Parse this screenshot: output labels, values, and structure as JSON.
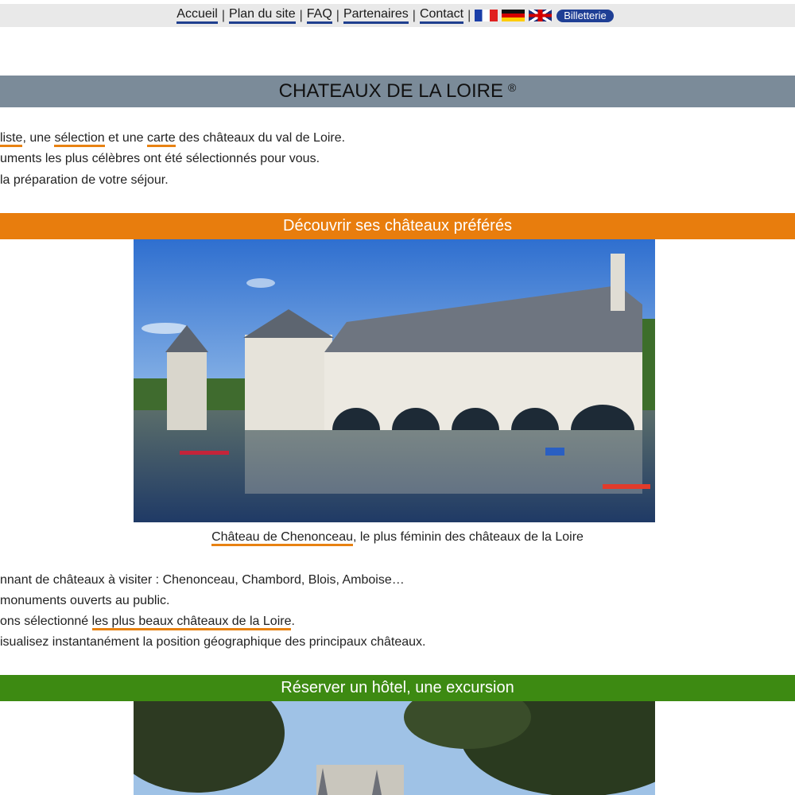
{
  "nav": {
    "links": [
      "Accueil",
      "Plan du site",
      "FAQ",
      "Partenaires",
      "Contact"
    ],
    "separator": "|",
    "flags": [
      "flag-fr",
      "flag-de",
      "flag-uk"
    ],
    "ticket_label": "Billetterie"
  },
  "header": {
    "title": "CHATEAUX DE LA LOIRE",
    "mark": "®"
  },
  "intro": {
    "line1": {
      "a": "liste",
      "b": ", une ",
      "c": "sélection",
      "d": " et une ",
      "e": "carte",
      "f": " des châteaux du val de Loire."
    },
    "line2": "uments les plus célèbres ont été sélectionnés pour vous.",
    "line3": "la préparation de votre séjour."
  },
  "section1": {
    "title": "Découvrir ses châteaux préférés",
    "caption_link": "Château de Chenonceau",
    "caption_rest": ", le plus féminin des châteaux de la Loire"
  },
  "body2": {
    "line1": "nnant de châteaux à visiter : Chenonceau, Chambord, Blois, Amboise…",
    "line2": " monuments ouverts au public.",
    "line3_pre": "ons sélectionné ",
    "line3_link": "les plus beaux châteaux de la Loire",
    "line3_post": ".",
    "line4": "isualisez instantanément la position géographique des principaux châteaux."
  },
  "section2": {
    "title": "Réserver un hôtel, une excursion"
  },
  "colors": {
    "accent_orange": "#e87d0d",
    "accent_green": "#3d8a12",
    "nav_blue": "#1f3f8f",
    "title_gray": "#7b8b99"
  }
}
